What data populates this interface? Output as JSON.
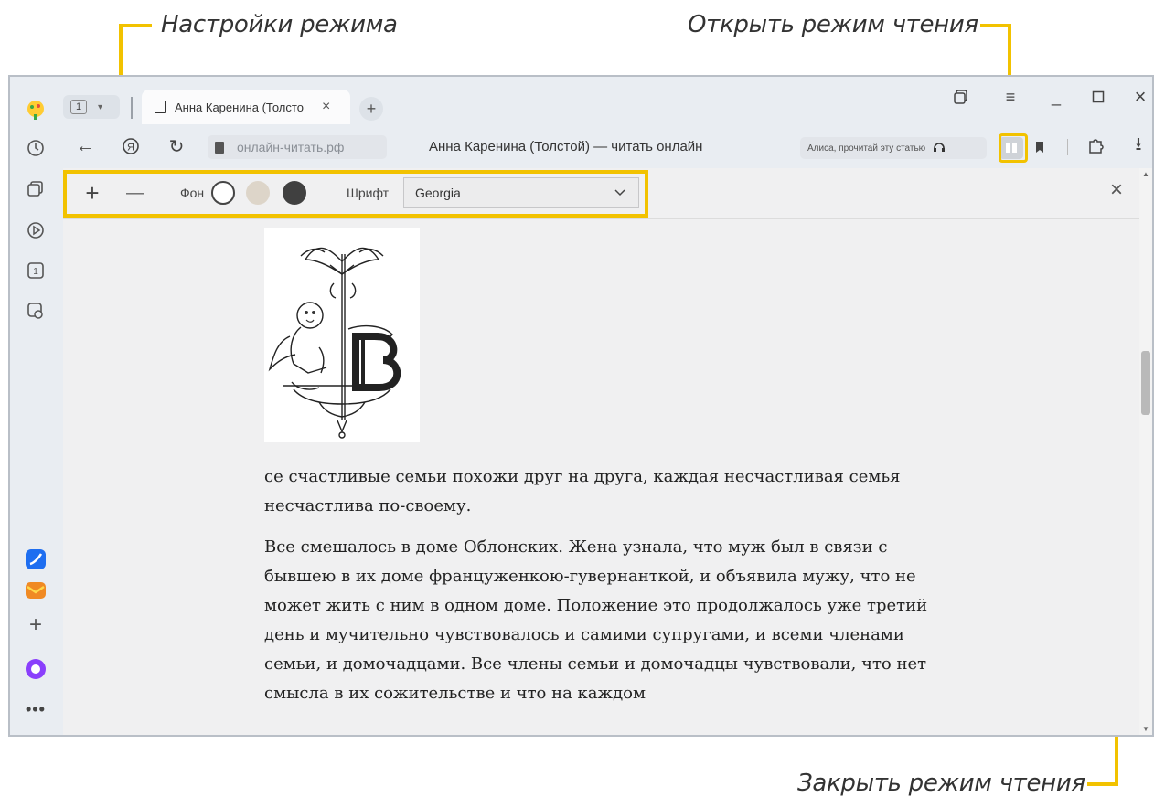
{
  "callouts": {
    "mode_settings": "Настройки режима",
    "open_reader": "Открыть режим чтения",
    "close_reader": "Закрыть режим чтения"
  },
  "tabs": {
    "counter": "1",
    "active_tab_title": "Анна Каренина (Толсто"
  },
  "toolbar": {
    "address": "онлайн-читать.рф",
    "page_title": "Анна Каренина (Толстой) — читать онлайн",
    "alice_button": "Алиса, прочитай эту статью"
  },
  "reader": {
    "plus": "+",
    "minus": "—",
    "background_label": "Фон",
    "font_label": "Шрифт",
    "font_value": "Georgia",
    "close": "×"
  },
  "article": {
    "paragraphs": [
      "се счастливые семьи похожи друг на друга, каждая несчастливая семья несчастлива по-своему.",
      "Все смешалось в доме Облонских. Жена узнала, что муж был в связи с бывшею в их доме француженкою-гувернанткой, и объявила мужу, что не может жить с ним в одном доме. Положение это продолжалось уже третий день и мучительно чувствовалось и самими супругами, и всеми членами семьи, и домочадцами. Все члены семьи и домочадцы чувствовали, что нет смысла в их сожительстве и что на каждом"
    ]
  },
  "colors": {
    "accent": "#f2c200",
    "swatch_white": "#ffffff",
    "swatch_beige": "#ddd5c9",
    "swatch_dark": "#404040"
  },
  "icons": [
    "yandex-logo-icon",
    "history-icon",
    "collections-icon",
    "play-icon",
    "counter-icon",
    "screenshot-icon",
    "messenger-icon",
    "mail-icon",
    "add-icon",
    "alice-icon",
    "more-icon"
  ]
}
